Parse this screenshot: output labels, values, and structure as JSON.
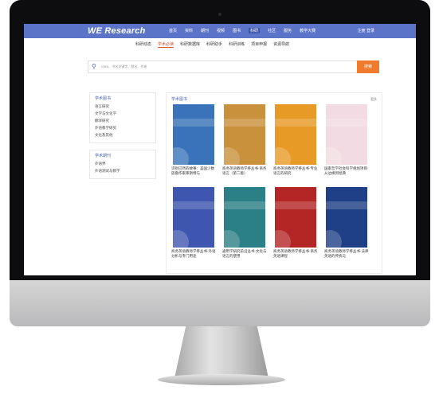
{
  "app": {
    "logo": "WE Research"
  },
  "topnav": {
    "items": [
      "首页",
      "资料",
      "期刊",
      "视频",
      "图书",
      "科研",
      "社区",
      "服务",
      "教学大赛"
    ],
    "active_index": 5,
    "login": "注册 登录"
  },
  "subnav": {
    "items": [
      "科研动态",
      "学术必读",
      "科研数据库",
      "科研助手",
      "科研训练",
      "项目申报",
      "资源导航"
    ],
    "active_index": 1
  },
  "search": {
    "placeholder": "ISBN、书名关键字、题名、作者",
    "button": "搜索"
  },
  "sidebar": {
    "groups": [
      {
        "title": "学术图书",
        "items": [
          "语言研究",
          "文学与文化学",
          "翻译研究",
          "外语教学研究",
          "文化及其他"
        ]
      },
      {
        "title": "学术期刊",
        "items": [
          "外语界",
          "外语测试与教学"
        ]
      }
    ]
  },
  "main": {
    "title": "学术图书",
    "more": "更多"
  },
  "books": [
    {
      "caption": "识别已然的故事：美国少数族裔作家库斯特与",
      "color": "#3a73b9"
    },
    {
      "caption": "商务英语教师学养丛书·商务语言（第二版）",
      "color": "#c9913b"
    },
    {
      "caption": "商务英语教师学养丛书·专业语言的研究",
      "color": "#e89a26"
    },
    {
      "caption": "国家哲学社会科学规划项目·从边缘到经典",
      "color": "#f2dbe2"
    },
    {
      "caption": "商务英语教师学养丛书·外语分析与专门用途",
      "color": "#3e56b0"
    },
    {
      "caption": "通用学研究前沿丛书·文化与语言的使用",
      "color": "#2b7f86"
    },
    {
      "caption": "商务英语教师学养丛书·商务英语课程",
      "color": "#b42626"
    },
    {
      "caption": "商务英语教师学养丛书·法律英语的传统与",
      "color": "#1f3f86"
    }
  ]
}
